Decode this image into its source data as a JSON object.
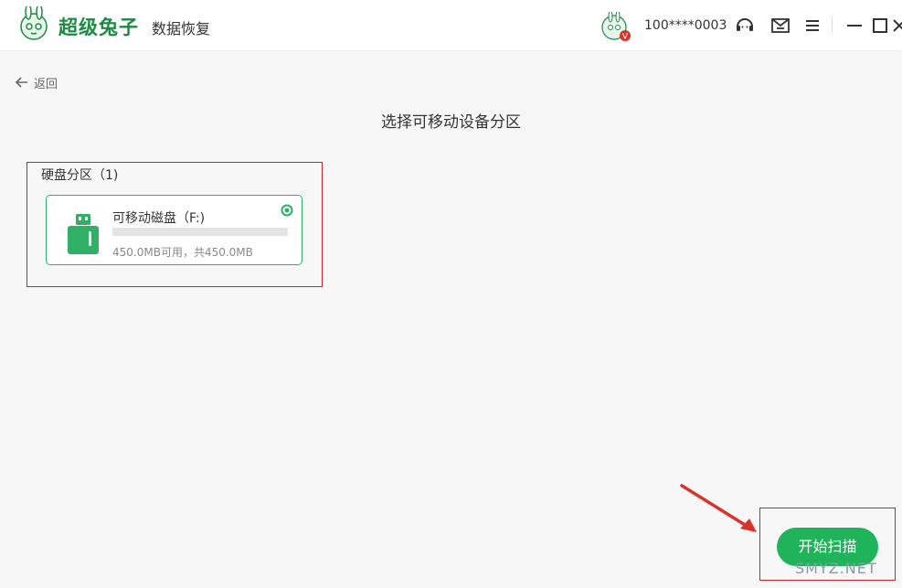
{
  "app": {
    "brand": "超级兔子",
    "product": "数据恢复",
    "username": "100****0003",
    "vip_badge": "V"
  },
  "nav": {
    "back_label": "返回"
  },
  "page": {
    "title": "选择可移动设备分区"
  },
  "section": {
    "label": "硬盘分区（1)",
    "drives": [
      {
        "name": "可移动磁盘（F:)",
        "capacity": "450.0MB可用，共450.0MB",
        "used_fraction": 0.0,
        "selected": true
      }
    ]
  },
  "actions": {
    "scan_label": "开始扫描"
  },
  "watermark": {
    "text": "SMYZ.NET"
  },
  "colors": {
    "accent": "#1fb45a",
    "annotation_red": "#c8232b",
    "brand_green": "#1c8a43"
  },
  "icons": [
    "rabbit-logo",
    "avatar",
    "support-icon",
    "message-icon",
    "menu-icon",
    "minimize-icon",
    "maximize-icon",
    "close-icon",
    "back-arrow-icon",
    "usb-drive-icon",
    "radio-selected-icon"
  ]
}
